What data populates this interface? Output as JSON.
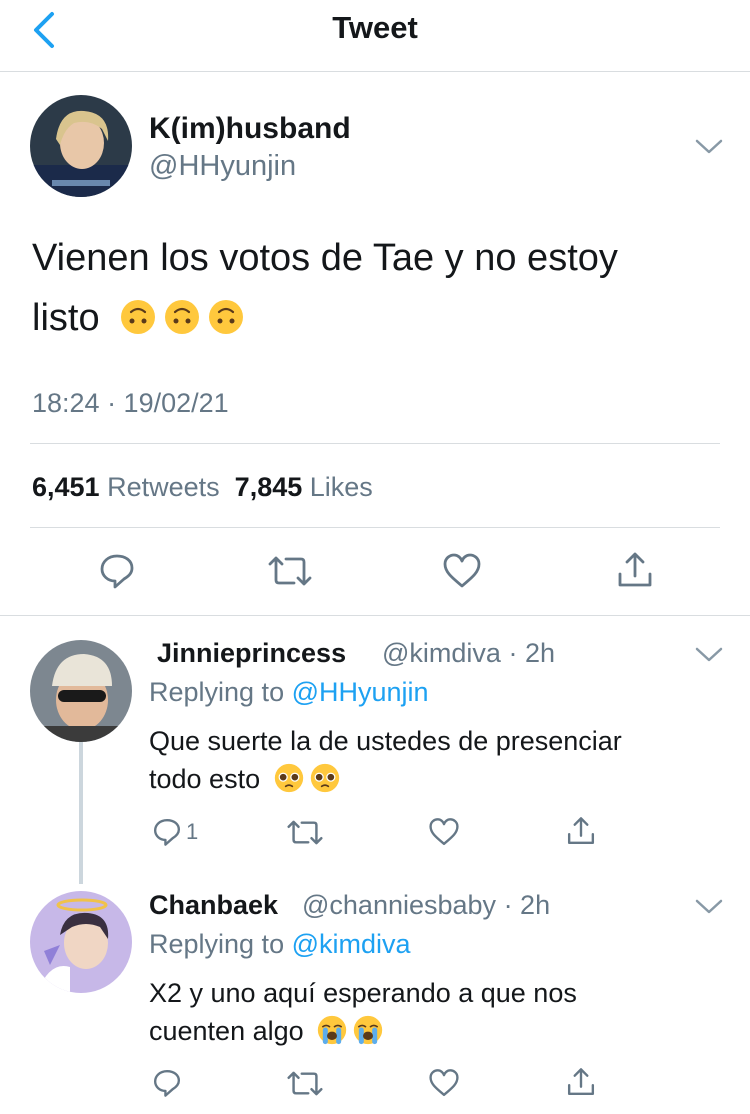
{
  "header": {
    "title": "Tweet"
  },
  "tweet": {
    "name": "K(im)husband",
    "handle": "@HHyunjin",
    "text_line1": "Vienen los votos de Tae y no estoy",
    "text_line2": "listo",
    "emoji": "upside-down-face",
    "timestamp": "18:24 · 19/02/21",
    "retweets_count": "6,451",
    "retweets_label": "Retweets",
    "likes_count": "7,845",
    "likes_label": "Likes"
  },
  "replies": [
    {
      "name": "Jinnieprincess",
      "handle": "@kimdiva",
      "time": "· 2h",
      "replying_prefix": "Replying to",
      "replying_to": "@HHyunjin",
      "text_line1": "Que suerte la de ustedes de presenciar",
      "text_line2": "todo esto",
      "emoji": "pleading-face",
      "reply_count": "1"
    },
    {
      "name": "Chanbaek",
      "handle": "@channiesbaby",
      "time": "· 2h",
      "replying_prefix": "Replying to",
      "replying_to": "@kimdiva",
      "text_line1": "X2 y uno aquí esperando a que nos",
      "text_line2": "cuenten algo",
      "emoji": "loudly-crying-face"
    }
  ],
  "colors": {
    "accent": "#1da1f2",
    "muted": "#657786",
    "text": "#14171a",
    "divider": "#d9dde0",
    "emoji_yellow": "#ffc83d"
  }
}
